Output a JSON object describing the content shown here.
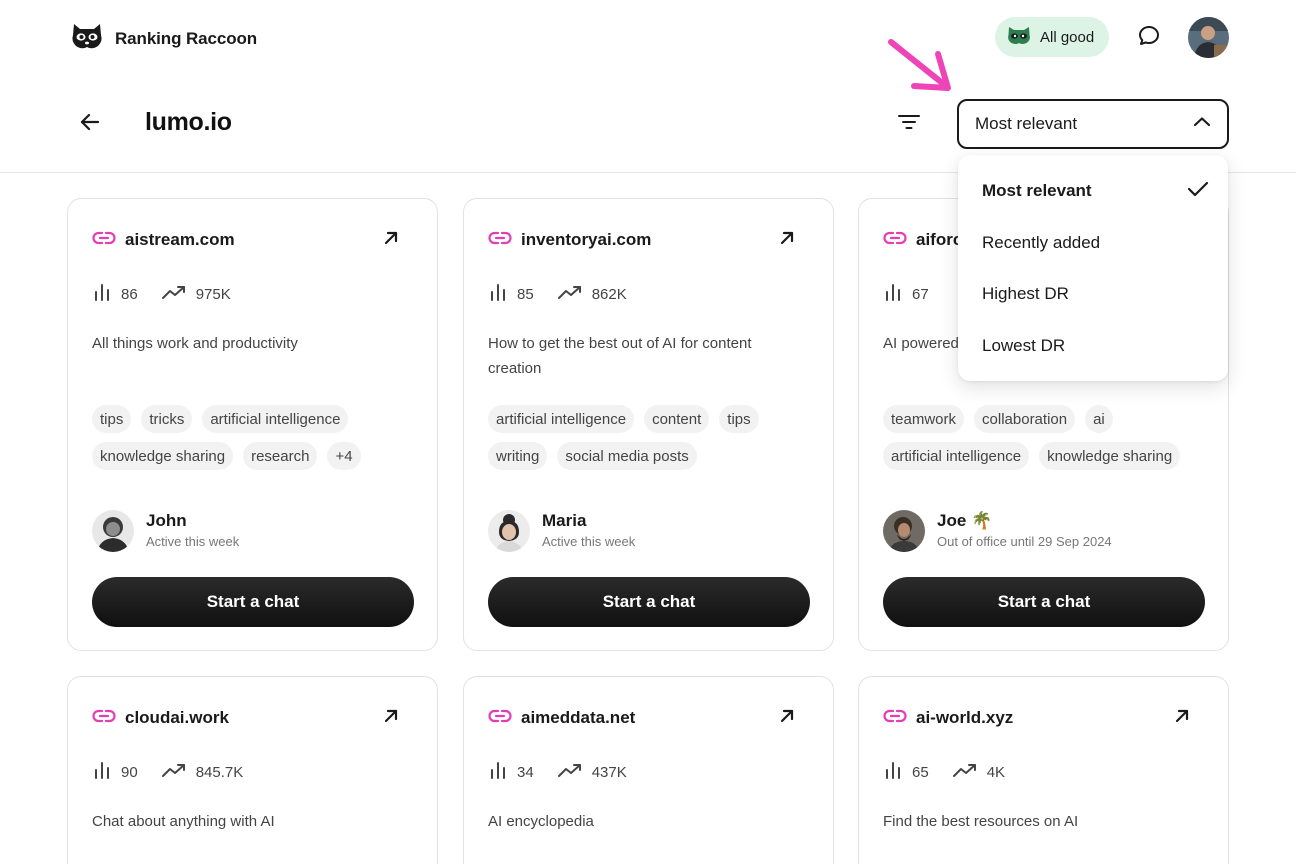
{
  "brand": {
    "name": "Ranking Raccoon"
  },
  "status": {
    "label": "All good"
  },
  "header": {
    "title": "lumo.io"
  },
  "sort": {
    "selected": "Most relevant",
    "options": [
      "Most relevant",
      "Recently added",
      "Highest DR",
      "Lowest DR"
    ]
  },
  "colors": {
    "accent": "#e23fb5",
    "status_bg": "#dcf3e6",
    "button": "#1a1a1a"
  },
  "cards": [
    {
      "domain": "aistream.com",
      "dr": "86",
      "traffic": "975K",
      "description": "All things work and productivity",
      "tags": [
        "tips",
        "tricks",
        "artificial intelligence",
        "knowledge sharing",
        "research",
        "+4"
      ],
      "person": {
        "name": "John",
        "status": "Active this week"
      },
      "cta": "Start a chat"
    },
    {
      "domain": "inventoryai.com",
      "dr": "85",
      "traffic": "862K",
      "description": "How to get the best out of AI for content creation",
      "tags": [
        "artificial intelligence",
        "content",
        "tips",
        "writing",
        "social media posts"
      ],
      "person": {
        "name": "Maria",
        "status": "Active this week"
      },
      "cta": "Start a chat"
    },
    {
      "domain": "aiforce.com",
      "dr": "67",
      "traffic": "",
      "description": "AI powered productivity",
      "tags": [
        "teamwork",
        "collaboration",
        "ai",
        "artificial intelligence",
        "knowledge sharing"
      ],
      "person": {
        "name": "Joe 🌴",
        "status": "Out of office until 29 Sep 2024"
      },
      "cta": "Start a chat"
    },
    {
      "domain": "cloudai.work",
      "dr": "90",
      "traffic": "845.7K",
      "description": "Chat about anything with AI"
    },
    {
      "domain": "aimeddata.net",
      "dr": "34",
      "traffic": "437K",
      "description": "AI encyclopedia"
    },
    {
      "domain": "ai-world.xyz",
      "dr": "65",
      "traffic": "4K",
      "description": "Find the best resources on AI"
    }
  ]
}
